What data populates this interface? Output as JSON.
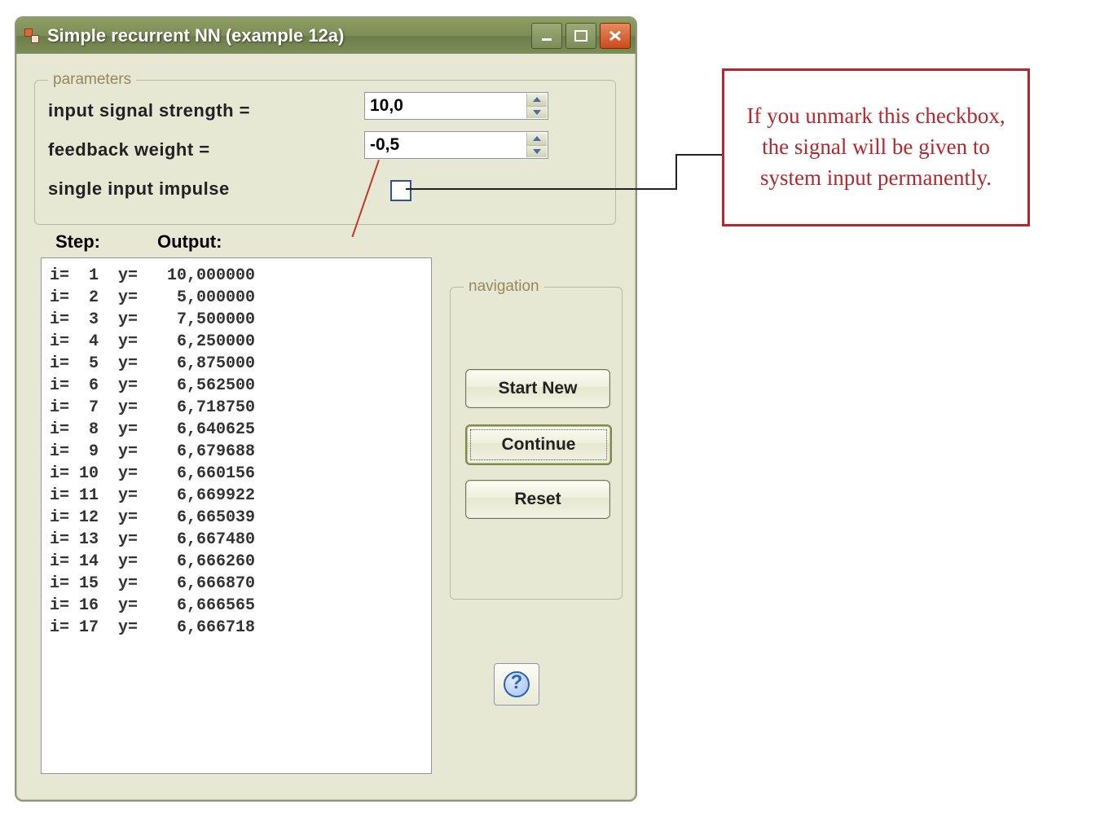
{
  "window": {
    "title": "Simple recurrent NN (example 12a)"
  },
  "params": {
    "legend": "parameters",
    "input_signal_label": "input signal strength =",
    "feedback_weight_label": "feedback weight     =",
    "single_impulse_label": "single input impulse",
    "input_signal_value": "10,0",
    "feedback_weight_value": "-0,5",
    "single_impulse_checked": false
  },
  "columns": {
    "step": "Step:",
    "output": "Output:"
  },
  "results": [
    {
      "i": 1,
      "y": "10,000000"
    },
    {
      "i": 2,
      "y": "5,000000"
    },
    {
      "i": 3,
      "y": "7,500000"
    },
    {
      "i": 4,
      "y": "6,250000"
    },
    {
      "i": 5,
      "y": "6,875000"
    },
    {
      "i": 6,
      "y": "6,562500"
    },
    {
      "i": 7,
      "y": "6,718750"
    },
    {
      "i": 8,
      "y": "6,640625"
    },
    {
      "i": 9,
      "y": "6,679688"
    },
    {
      "i": 10,
      "y": "6,660156"
    },
    {
      "i": 11,
      "y": "6,669922"
    },
    {
      "i": 12,
      "y": "6,665039"
    },
    {
      "i": 13,
      "y": "6,667480"
    },
    {
      "i": 14,
      "y": "6,666260"
    },
    {
      "i": 15,
      "y": "6,666870"
    },
    {
      "i": 16,
      "y": "6,666565"
    },
    {
      "i": 17,
      "y": "6,666718"
    }
  ],
  "nav": {
    "legend": "navigation",
    "start_new": "Start New",
    "continue": "Continue",
    "reset": "Reset"
  },
  "help": {
    "symbol": "?"
  },
  "annotation": {
    "text": "If you unmark this checkbox, the signal will be given to system input permanently."
  }
}
